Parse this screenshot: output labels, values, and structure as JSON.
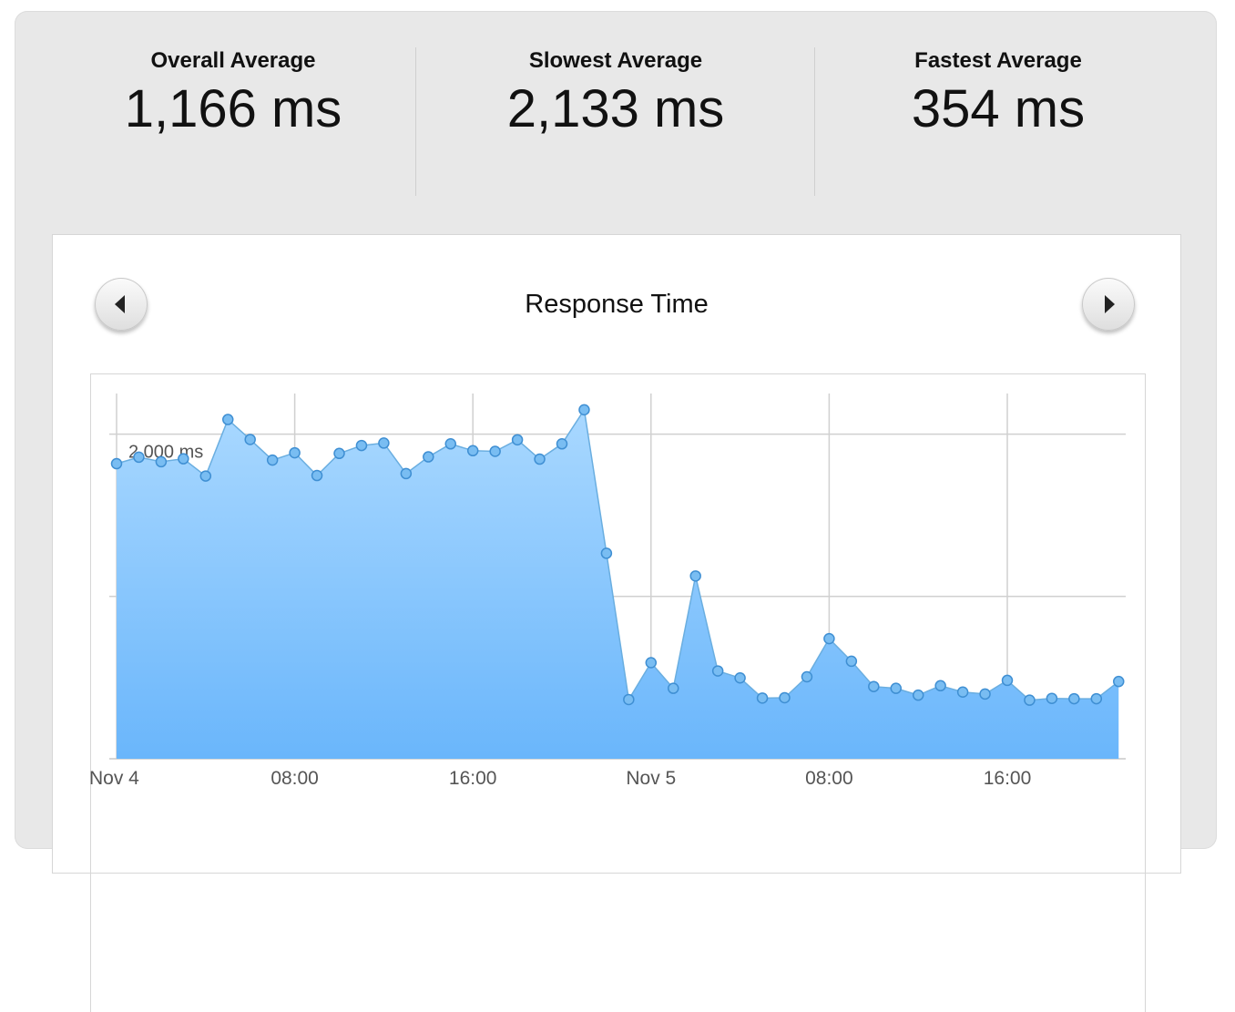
{
  "stats": [
    {
      "label": "Overall Average",
      "value": "1,166 ms"
    },
    {
      "label": "Slowest Average",
      "value": "2,133 ms"
    },
    {
      "label": "Fastest Average",
      "value": "354 ms"
    }
  ],
  "chart": {
    "prev_icon": "triangle-left",
    "next_icon": "triangle-right",
    "line_color": "#6aaee0",
    "fill_top": "#a9d8ff",
    "fill_bottom": "#6ab6fb"
  },
  "chart_data": {
    "type": "area",
    "title": "Response Time",
    "y_tick_label": "2,000 ms",
    "x_tick_labels": [
      "Nov 4",
      "08:00",
      "16:00",
      "Nov 5",
      "08:00",
      "16:00"
    ],
    "x_tick_hours": [
      0,
      8,
      16,
      24,
      32,
      40
    ],
    "ylim": [
      0,
      2250
    ],
    "y_gridlines": [
      1000,
      2000
    ],
    "x_hours": [
      0,
      1,
      2,
      3,
      4,
      5,
      6,
      7,
      8,
      9,
      10,
      11,
      12,
      13,
      14,
      15,
      16,
      17,
      18,
      19,
      20,
      21,
      22,
      23,
      24,
      25,
      26,
      27,
      28,
      29,
      30,
      31,
      32,
      33,
      34,
      35,
      36,
      37,
      38,
      39,
      40,
      41,
      42,
      43,
      44,
      45
    ],
    "values": [
      1818,
      1858,
      1830,
      1848,
      1742,
      2090,
      1967,
      1840,
      1885,
      1745,
      1881,
      1930,
      1945,
      1757,
      1860,
      1940,
      1898,
      1894,
      1965,
      1846,
      1940,
      2150,
      1266,
      365,
      592,
      434,
      1126,
      541,
      498,
      374,
      376,
      505,
      740,
      601,
      445,
      434,
      392,
      450,
      411,
      399,
      483,
      361,
      372,
      370,
      370,
      476
    ]
  }
}
